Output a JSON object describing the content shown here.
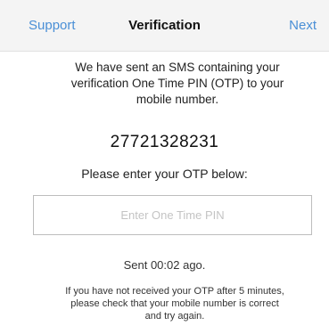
{
  "navbar": {
    "left_label": "Support",
    "title": "Verification",
    "right_label": "Next"
  },
  "main": {
    "message_line1": "We have sent an SMS containing your",
    "message_line2": "verification One Time PIN (OTP) to your",
    "message_line3": "mobile number.",
    "phone_number": "27721328231",
    "prompt": "Please enter your OTP below:",
    "otp_input": {
      "value": "",
      "placeholder": "Enter One Time PIN"
    },
    "sent_status": "Sent 00:02 ago.",
    "note_line1": "If you have not received your OTP after 5 minutes,",
    "note_line2": "please check that your mobile number is correct",
    "note_line3": "and try again."
  },
  "colors": {
    "accent": "#4a8fd6",
    "navbar_bg": "#f4f4f4",
    "field_border": "#bdbdbd"
  }
}
